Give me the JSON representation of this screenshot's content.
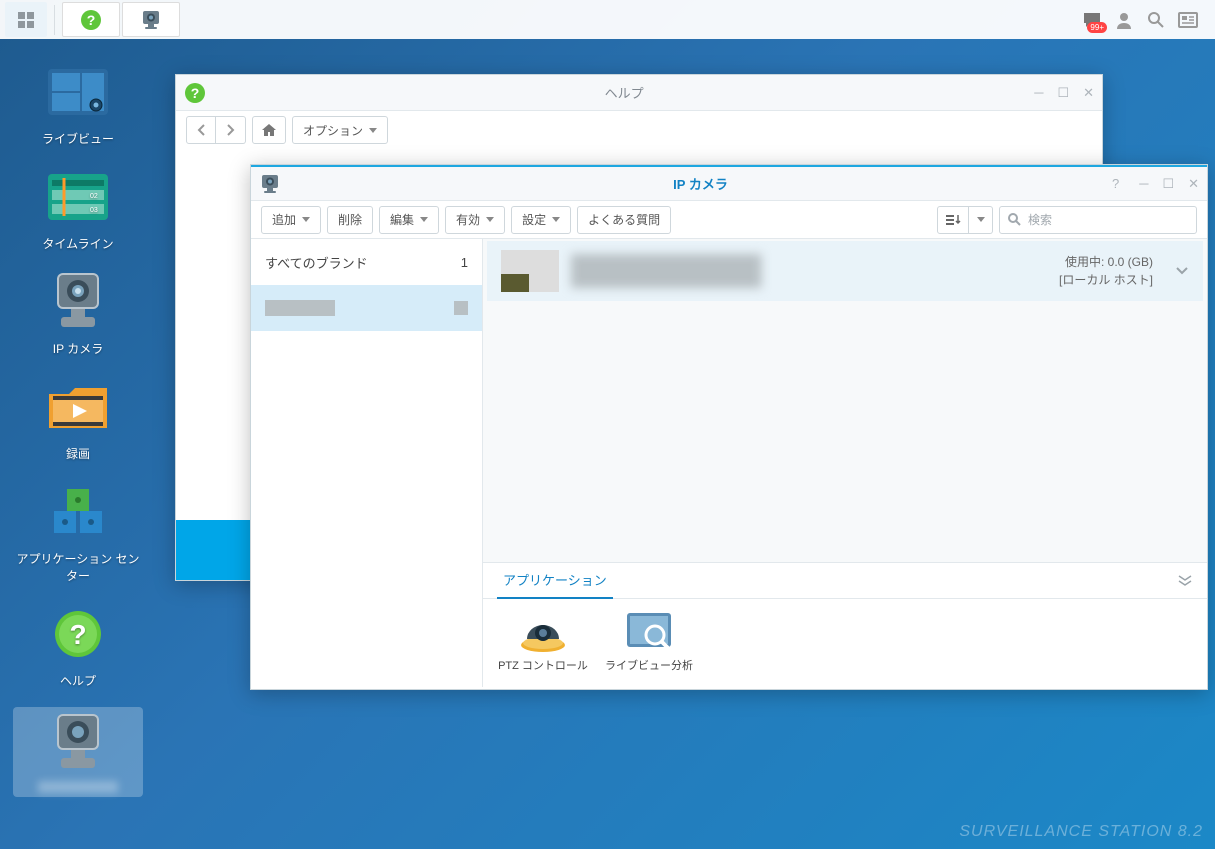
{
  "taskbar": {},
  "tray": {
    "badge": "99+"
  },
  "desktop": {
    "items": [
      {
        "label": "ライブビュー"
      },
      {
        "label": "タイムライン"
      },
      {
        "label": "IP カメラ"
      },
      {
        "label": "録画"
      },
      {
        "label": "アプリケーション センター"
      },
      {
        "label": "ヘルプ"
      },
      {
        "label": ""
      }
    ]
  },
  "help_window": {
    "title": "ヘルプ",
    "options_label": "オプション"
  },
  "ipcam_window": {
    "title": "IP カメラ",
    "toolbar": {
      "add": "追加",
      "delete": "削除",
      "edit": "編集",
      "enable": "有効",
      "settings": "設定",
      "faq": "よくある質問",
      "search_placeholder": "検索"
    },
    "sidebar": {
      "all_brands": "すべてのブランド",
      "all_brands_count": "1",
      "item2": "—"
    },
    "camera": {
      "usage_label": "使用中: 0.0 (GB)",
      "host_label": "[ローカル ホスト]"
    },
    "app_tab": "アプリケーション",
    "apps": [
      {
        "label": "PTZ コントロール"
      },
      {
        "label": "ライブビュー分析"
      }
    ]
  },
  "brand": "SURVEILLANCE STATION 8.2"
}
